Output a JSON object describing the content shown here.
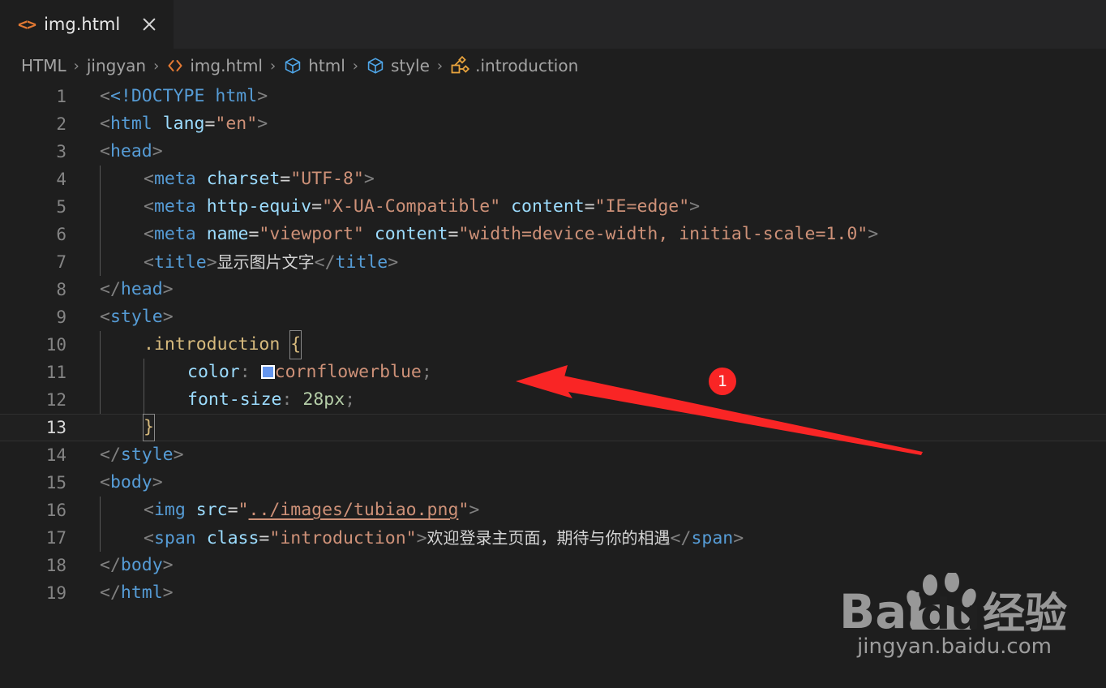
{
  "window": {
    "app": "Visual Studio Code",
    "theme_background": "#1e1e1e",
    "tabbar_background": "#252526"
  },
  "tab": {
    "icon": "html-file-icon",
    "icon_glyph": "<>",
    "label": "img.html",
    "close_icon": "close-icon",
    "active": true
  },
  "breadcrumb": {
    "items": [
      {
        "label": "HTML",
        "icon": "none"
      },
      {
        "label": "jingyan",
        "icon": "none"
      },
      {
        "label": "img.html",
        "icon": "html-file-icon"
      },
      {
        "label": "html",
        "icon": "symbol-cube-icon"
      },
      {
        "label": "style",
        "icon": "symbol-cube-icon"
      },
      {
        "label": ".introduction",
        "icon": "css-selector-icon"
      }
    ],
    "separator": "›"
  },
  "editor": {
    "active_line": 13,
    "lines": [
      {
        "n": "1",
        "text": "<!DOCTYPE html>"
      },
      {
        "n": "2",
        "text": "<html lang=\"en\">"
      },
      {
        "n": "3",
        "text": "<head>"
      },
      {
        "n": "4",
        "text": "    <meta charset=\"UTF-8\">"
      },
      {
        "n": "5",
        "text": "    <meta http-equiv=\"X-UA-Compatible\" content=\"IE=edge\">"
      },
      {
        "n": "6",
        "text": "    <meta name=\"viewport\" content=\"width=device-width, initial-scale=1.0\">"
      },
      {
        "n": "7",
        "text": "    <title>显示图片文字</title>"
      },
      {
        "n": "8",
        "text": "</head>"
      },
      {
        "n": "9",
        "text": "<style>"
      },
      {
        "n": "10",
        "text": "    .introduction {"
      },
      {
        "n": "11",
        "text": "        color: cornflowerblue;"
      },
      {
        "n": "12",
        "text": "        font-size: 28px;"
      },
      {
        "n": "13",
        "text": "    }"
      },
      {
        "n": "14",
        "text": "</style>"
      },
      {
        "n": "15",
        "text": "<body>"
      },
      {
        "n": "16",
        "text": "    <img src=\"../images/tubiao.png\">"
      },
      {
        "n": "17",
        "text": "    <span class=\"introduction\">欢迎登录主页面，期待与你的相遇</span>"
      },
      {
        "n": "18",
        "text": "</body>"
      },
      {
        "n": "19",
        "text": "</html>"
      }
    ],
    "tokens": {
      "doctype": "<!DOCTYPE",
      "tag_html": "html",
      "attr_lang": "lang",
      "val_en": "\"en\"",
      "tag_head": "head",
      "tag_meta": "meta",
      "attr_charset": "charset",
      "val_utf8": "\"UTF-8\"",
      "attr_httpequiv": "http-equiv",
      "val_xua": "\"X-UA-Compatible\"",
      "attr_content": "content",
      "val_ieedge": "\"IE=edge\"",
      "attr_name": "name",
      "val_viewport": "\"viewport\"",
      "val_widthdevice": "\"width=device-width, initial-scale=1.0\"",
      "tag_title": "title",
      "title_text": "显示图片文字",
      "tag_style": "style",
      "selector_introduction": ".introduction",
      "prop_color": "color",
      "val_cornflowerblue": "cornflowerblue",
      "prop_fontsize": "font-size",
      "val_28px": "28px",
      "tag_body": "body",
      "tag_img": "img",
      "attr_src": "src",
      "val_imgpath": "../images/tubiao.png",
      "tag_span": "span",
      "attr_class": "class",
      "val_introduction": "\"introduction\"",
      "span_text": "欢迎登录主页面，期待与你的相遇"
    },
    "color_swatch": {
      "name": "cornflowerblue-swatch",
      "hex": "#6495ed"
    },
    "syntax_colors": {
      "tag": "#569cd6",
      "attribute": "#9cdcfe",
      "string": "#ce9178",
      "selector": "#d7ba7d",
      "number": "#b5cea8",
      "punctuation": "#808080",
      "plain_text": "#d4d4d4"
    }
  },
  "annotation": {
    "arrow_color": "#f92525",
    "badge_label": "1",
    "badge_color": "#f92525"
  },
  "watermark": {
    "brand_left": "Bai",
    "brand_right": "du",
    "brand_cn": "经验",
    "url": "jingyan.baidu.com"
  }
}
